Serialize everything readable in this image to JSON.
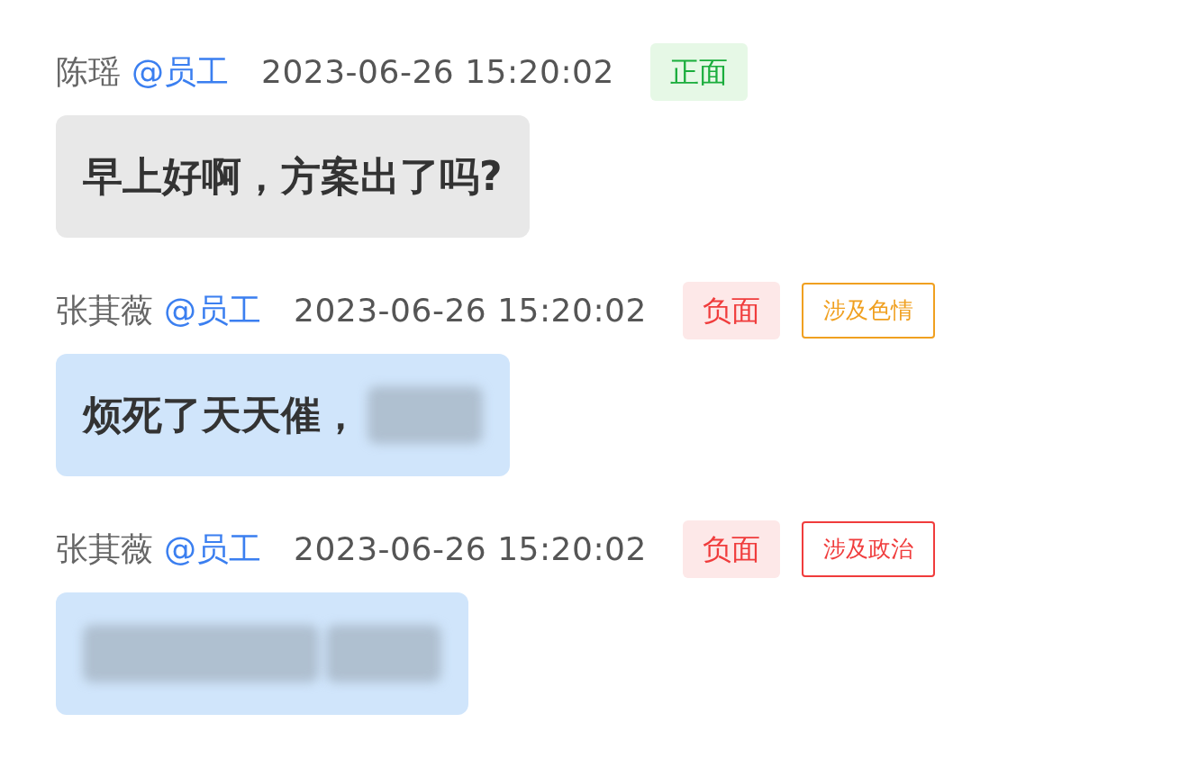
{
  "messages": [
    {
      "sender": "陈瑶",
      "role": "@员工",
      "time": "2023-06-26 15:20:02",
      "sentiment": {
        "kind": "positive",
        "label": "正面"
      },
      "color": "#e8e8e8",
      "parts": [
        {
          "kind": "text",
          "text": "早上好啊，方案出了吗?"
        }
      ]
    },
    {
      "sender": "张萁薇",
      "role": "@员工",
      "time": "2023-06-26 15:20:02",
      "sentiment": {
        "kind": "negative",
        "label": "负面"
      },
      "tags": [
        {
          "label": "涉及色情",
          "color": "#f0a020"
        }
      ],
      "color": "#d0e5fb",
      "parts": [
        {
          "kind": "text",
          "text": "烦死了天天催，"
        },
        {
          "kind": "blurword"
        }
      ]
    },
    {
      "sender": "张萁薇",
      "role": "@员工",
      "time": "2023-06-26 15:20:02",
      "sentiment": {
        "kind": "negative",
        "label": "负面"
      },
      "tags": [
        {
          "label": "涉及政治",
          "color": "#f03c3c"
        }
      ],
      "color": "#d0e5fb",
      "parts": [
        {
          "kind": "blurphrase"
        },
        {
          "kind": "blurword"
        }
      ]
    }
  ]
}
